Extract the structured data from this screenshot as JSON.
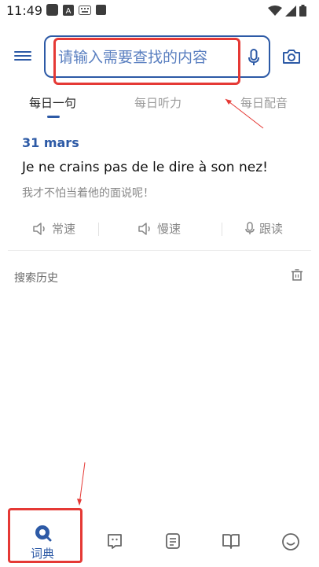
{
  "status_bar": {
    "time": "11:49"
  },
  "search": {
    "placeholder": "请输入需要查找的内容"
  },
  "tabs": [
    {
      "label": "每日一句",
      "active": true
    },
    {
      "label": "每日听力",
      "active": false
    },
    {
      "label": "每日配音",
      "active": false
    }
  ],
  "daily_sentence": {
    "date": "31 mars",
    "text": "Je ne crains pas de le dire à son nez!",
    "translation": "我才不怕当着他的面说呢！"
  },
  "actions": [
    {
      "label": "常速",
      "icon": "speaker-icon"
    },
    {
      "label": "慢速",
      "icon": "speaker-icon"
    },
    {
      "label": "跟读",
      "icon": "mic-icon"
    }
  ],
  "history": {
    "title": "搜索历史"
  },
  "bottom_nav": [
    {
      "label": "词典",
      "icon": "search-icon",
      "active": true
    },
    {
      "label": "",
      "icon": "chat-icon"
    },
    {
      "label": "",
      "icon": "notes-icon"
    },
    {
      "label": "",
      "icon": "book-icon"
    },
    {
      "label": "",
      "icon": "smile-icon"
    }
  ],
  "colors": {
    "accent": "#2d5aa6",
    "annotation": "#e53935",
    "muted": "#888888"
  }
}
